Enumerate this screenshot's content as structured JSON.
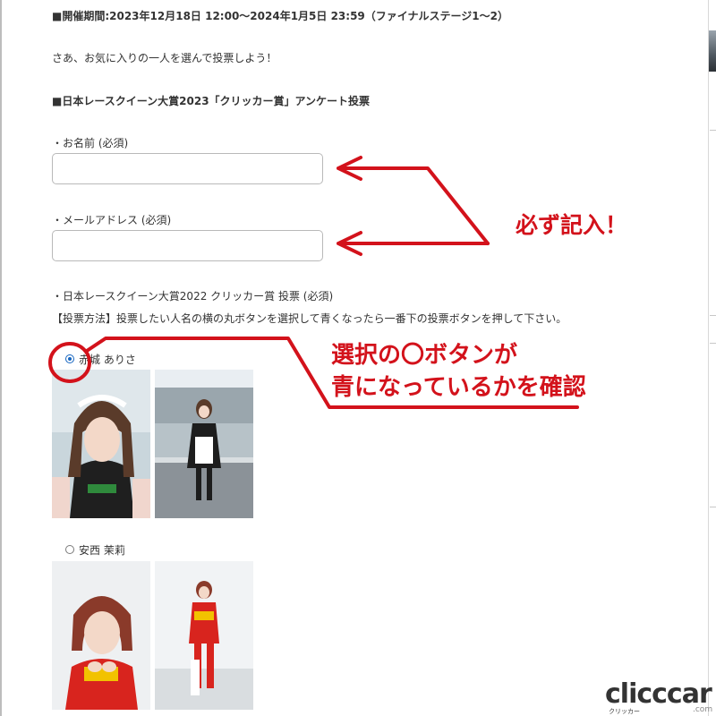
{
  "period": "■開催期間:2023年12月18日 12:00〜2024年1月5日 23:59（ファイナルステージ1〜2）",
  "intro": "さあ、お気に入りの一人を選んで投票しよう！",
  "survey_title": "■日本レースクイーン大賞2023「クリッカー賞」アンケート投票",
  "form": {
    "name_label": "・お名前 (必須)",
    "name_value": "",
    "email_label": "・メールアドレス (必須)",
    "email_value": "",
    "vote_label": "・日本レースクイーン大賞2022 クリッカー賞 投票 (必須)",
    "vote_method": "【投票方法】投票したい人名の横の丸ボタンを選択して青くなったら一番下の投票ボタンを押して下さい。"
  },
  "candidates": [
    {
      "name": "赤城 ありさ",
      "selected": true
    },
    {
      "name": "安西 茉莉",
      "selected": false
    }
  ],
  "annotations": {
    "required_note": "必ず記入！",
    "radio_note_line1": "選択の〇ボタンが",
    "radio_note_line2": "青になっているかを確認",
    "color": "#d3121b"
  },
  "logo": {
    "main": "clicccar",
    "sub": "クリッカー",
    "suffix": ".com"
  }
}
